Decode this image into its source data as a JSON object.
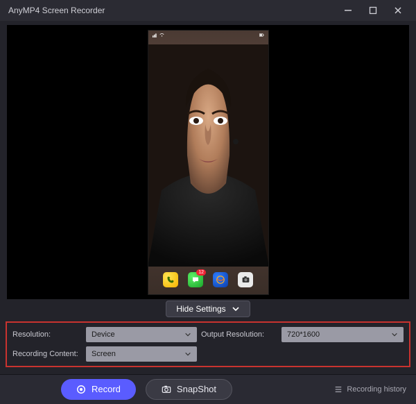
{
  "titlebar": {
    "title": "AnyMP4 Screen Recorder"
  },
  "phone_status": {
    "time": "",
    "badge_msg": "12"
  },
  "controls": {
    "hide_settings": "Hide Settings",
    "labels": {
      "resolution": "Resolution:",
      "output_resolution": "Output Resolution:",
      "recording_content": "Recording Content:"
    },
    "values": {
      "resolution": "Device",
      "output_resolution": "720*1600",
      "recording_content": "Screen"
    }
  },
  "bottombar": {
    "record": "Record",
    "snapshot": "SnapShot",
    "history": "Recording history"
  }
}
